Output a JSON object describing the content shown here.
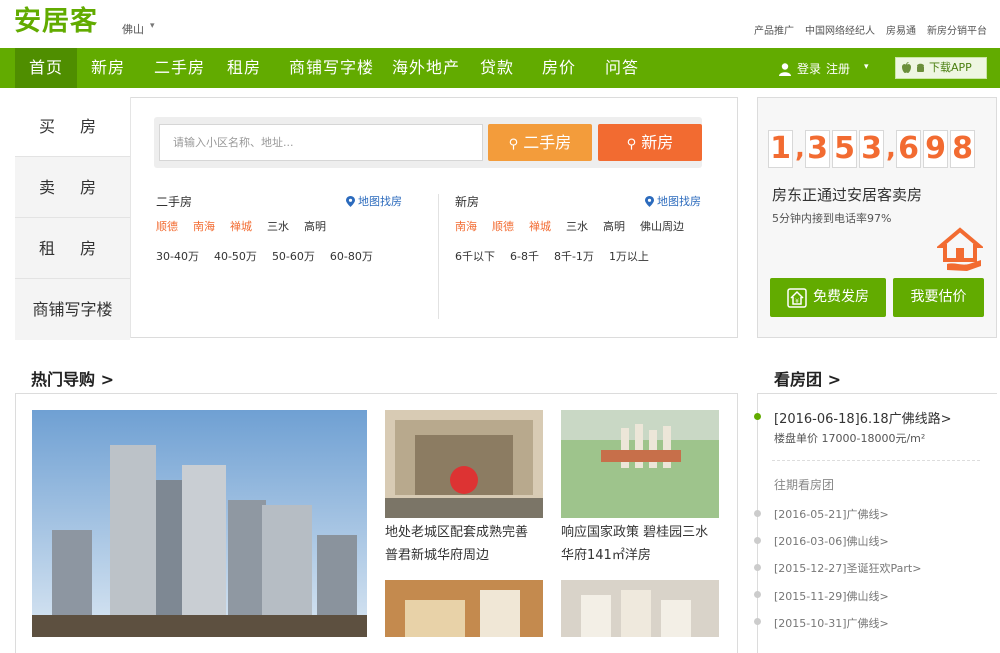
{
  "header": {
    "logo": "安居客",
    "city": "佛山",
    "links": [
      "产品推广",
      "中国网络经纪人",
      "房易通",
      "新房分销平台"
    ]
  },
  "nav": {
    "items": [
      "首页",
      "新房",
      "二手房",
      "租房",
      "商铺写字楼",
      "海外地产",
      "贷款",
      "房价",
      "问答"
    ],
    "login": "登录",
    "register": "注册",
    "download": "下载APP"
  },
  "left_tabs": [
    "买 房",
    "卖 房",
    "租 房",
    "商铺写字楼"
  ],
  "search": {
    "placeholder": "请输入小区名称、地址...",
    "btn_ershou": "二手房",
    "btn_xin": "新房"
  },
  "ershou": {
    "title": "二手房",
    "map_link": "地图找房",
    "areas": [
      "顺德",
      "南海",
      "禅城",
      "三水",
      "高明"
    ],
    "prices": [
      "30-40万",
      "40-50万",
      "50-60万",
      "60-80万"
    ]
  },
  "xinfang": {
    "title": "新房",
    "map_link": "地图找房",
    "areas": [
      "南海",
      "顺德",
      "禅城",
      "三水",
      "高明",
      "佛山周边"
    ],
    "prices": [
      "6千以下",
      "6-8千",
      "8千-1万",
      "1万以上"
    ]
  },
  "seller": {
    "digits": [
      "1",
      ",",
      "3",
      "5",
      "3",
      ",",
      "6",
      "9",
      "8"
    ],
    "headline": "房东正通过安居客卖房",
    "sub": "5分钟内接到电话率97%",
    "btn_free": "免费发房",
    "btn_estimate": "我要估价"
  },
  "hot": {
    "title": "热门导购 >",
    "cap1": "地处老城区配套成熟完善",
    "cap1b": "普君新城华府周边",
    "cap2": "响应国家政策 碧桂园三水",
    "cap2b": "华府141㎡洋房"
  },
  "tour": {
    "title": "看房团 >",
    "current": "[2016-06-18]6.18广佛线路>",
    "price": "楼盘单价 17000-18000元/m²",
    "past_title": "往期看房团",
    "past": [
      "[2016-05-21]广佛线>",
      "[2016-03-06]佛山线>",
      "[2015-12-27]圣诞狂欢Part>",
      "[2015-11-29]佛山线>",
      "[2015-10-31]广佛线>"
    ]
  },
  "colors": {
    "brand_green": "#62ab00",
    "orange": "#f26b31",
    "light_orange": "#f39c3b"
  }
}
